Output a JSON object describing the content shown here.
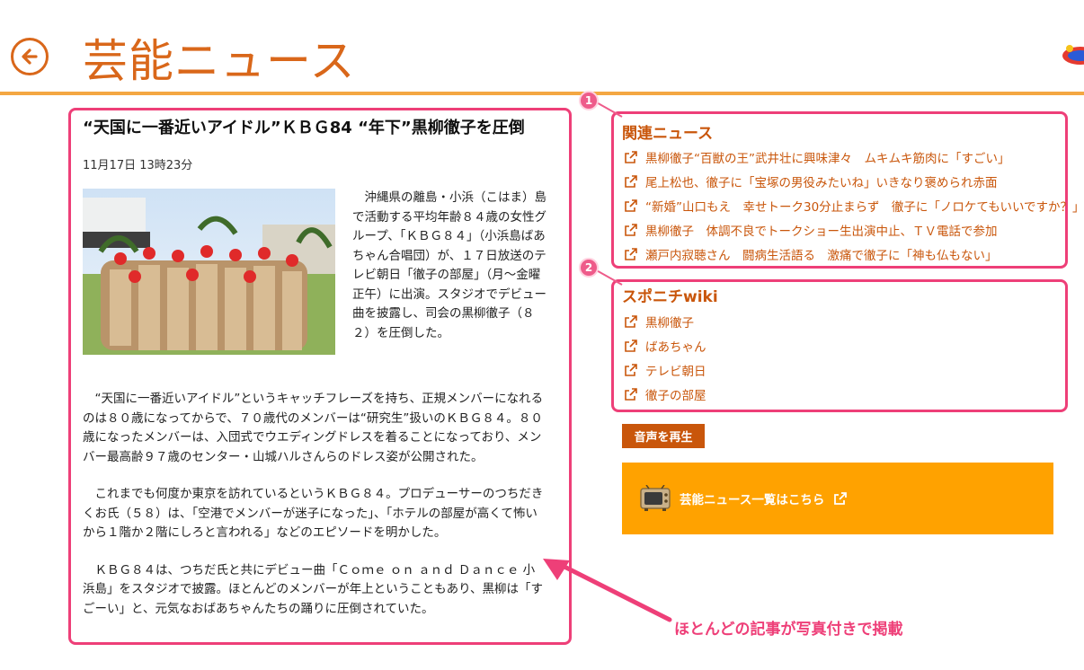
{
  "header": {
    "title": "芸能ニュース",
    "back_icon": "back-arrow-icon",
    "accent_color": "#d9671a"
  },
  "article": {
    "title": "“天国に一番近いアイドル”ＫＢＧ84 “年下”黒柳徹子を圧倒",
    "date": "11月17日 13時23分",
    "paragraphs": [
      "　沖縄県の離島・小浜（こはま）島で活動する平均年齢８４歳の女性グループ、「ＫＢＧ８４」（小浜島ばあちゃん合唱団）が、１７日放送のテレビ朝日「徹子の部屋」（月～金曜正午）に出演。スタジオでデビュー曲を披露し、司会の黒柳徹子（８２）を圧倒した。",
      "　“天国に一番近いアイドル”というキャッチフレーズを持ち、正規メンバーになれるのは８０歳になってからで、７０歳代のメンバーは“研究生”扱いのＫＢＧ８４。８０歳になったメンバーは、入団式でウエディングドレスを着ることになっており、メンバー最高齢９７歳のセンター・山城ハルさんらのドレス姿が公開された。",
      "　これまでも何度か東京を訪れているというＫＢＧ８４。プロデューサーのつちだきくお氏（５８）は、「空港でメンバーが迷子になった」、「ホテルの部屋が高くて怖いから１階か２階にしろと言われる」などのエピソードを明かした。",
      "　ＫＢＧ８４は、つちだ氏と共にデビュー曲「Ｃｏｍｅ ｏｎ ａｎｄ Ｄａｎｃｅ 小浜島」をスタジオで披露。ほとんどのメンバーが年上ということもあり、黒柳は「すごーい」と、元気なおばあちゃんたちの踊りに圧倒されていた。"
    ]
  },
  "related": {
    "badge": "1",
    "heading": "関連ニュース",
    "items": [
      "黒柳徹子“百獣の王”武井壮に興味津々　ムキムキ筋肉に「すごい」",
      "尾上松也、徹子に「宝塚の男役みたいね」いきなり褒められ赤面",
      "“新婚”山口もえ　幸せトーク30分止まらず　徹子に「ノロケてもいいですか？」",
      "黒柳徹子　体調不良でトークショー生出演中止、ＴＶ電話で参加",
      "瀬戸内寂聴さん　闘病生活語る　激痛で徹子に「神も仏もない」"
    ]
  },
  "wiki": {
    "badge": "2",
    "heading": "スポニチwiki",
    "items": [
      "黒柳徹子",
      "ばあちゃん",
      "テレビ朝日",
      "徹子の部屋"
    ]
  },
  "audio_button": {
    "label": "音声を再生"
  },
  "news_banner": {
    "label": "芸能ニュース一覧はこちら",
    "icon": "tv-icon",
    "color": "#ffa200"
  },
  "annotation": {
    "caption": "ほとんどの記事が写真付きで掲載",
    "color": "#ee3f78"
  }
}
